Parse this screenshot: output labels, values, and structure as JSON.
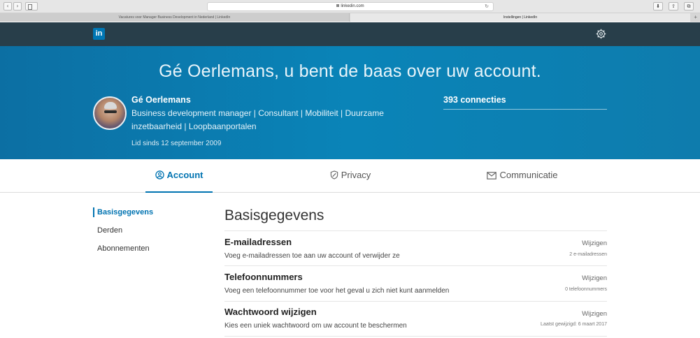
{
  "browser": {
    "url": "linkedin.com",
    "tabs": [
      {
        "label": "Vacatures voor Manager Business Development in Nederland | LinkedIn"
      },
      {
        "label": "Instellingen | LinkedIn"
      }
    ]
  },
  "nav": {
    "logo": "in"
  },
  "hero": {
    "title": "Gé Oerlemans, u bent de baas over uw account.",
    "name": "Gé Oerlemans",
    "headline": "Business development manager | Consultant | Mobiliteit | Duurzame inzetbaarheid | Loopbaanportalen",
    "member_since": "Lid sinds 12 september 2009",
    "connections": "393 connecties"
  },
  "section_tabs": [
    {
      "label": "Account",
      "icon": "account-icon",
      "active": true
    },
    {
      "label": "Privacy",
      "icon": "shield-icon"
    },
    {
      "label": "Communicatie",
      "icon": "envelope-icon"
    }
  ],
  "subnav": [
    {
      "label": "Basisgegevens",
      "active": true
    },
    {
      "label": "Derden"
    },
    {
      "label": "Abonnementen"
    }
  ],
  "main": {
    "title": "Basisgegevens",
    "rows": [
      {
        "title": "E-mailadressen",
        "description": "Voeg e-mailadressen toe aan uw account of verwijder ze",
        "action": "Wijzigen",
        "meta": "2 e-mailadressen"
      },
      {
        "title": "Telefoonnummers",
        "description": "Voeg een telefoonnummer toe voor het geval u zich niet kunt aanmelden",
        "action": "Wijzigen",
        "meta": "0 telefoonnummers"
      },
      {
        "title": "Wachtwoord wijzigen",
        "description": "Kies een uniek wachtwoord om uw account te beschermen",
        "action": "Wijzigen",
        "meta": "Laatst gewijzigd: 6 maart 2017"
      }
    ]
  },
  "colors": {
    "brand": "#0073b1",
    "nav_bg": "#283e4a",
    "hero_bg": "#0a84b8"
  }
}
